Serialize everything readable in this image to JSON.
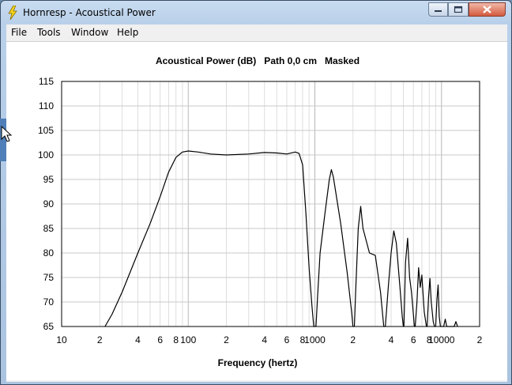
{
  "window": {
    "title": "Hornresp - Acoustical Power"
  },
  "menu": {
    "items": [
      "File",
      "Tools",
      "Window",
      "Help"
    ]
  },
  "chart_data": {
    "type": "line",
    "title": "Acoustical Power (dB)   Path 0,0 cm   Masked",
    "xlabel": "Frequency (hertz)",
    "ylabel": "",
    "x_scale": "log",
    "xlim": [
      10,
      20000
    ],
    "ylim": [
      65,
      115
    ],
    "yticks": [
      115,
      110,
      105,
      100,
      95,
      90,
      85,
      80,
      75,
      70,
      65
    ],
    "xtick_labels": [
      {
        "v": 10,
        "t": "10"
      },
      {
        "v": 20,
        "t": "2"
      },
      {
        "v": 40,
        "t": "4"
      },
      {
        "v": 60,
        "t": "6"
      },
      {
        "v": 80,
        "t": "8"
      },
      {
        "v": 100,
        "t": "100"
      },
      {
        "v": 200,
        "t": "2"
      },
      {
        "v": 400,
        "t": "4"
      },
      {
        "v": 600,
        "t": "6"
      },
      {
        "v": 800,
        "t": "8"
      },
      {
        "v": 1000,
        "t": "1000"
      },
      {
        "v": 2000,
        "t": "2"
      },
      {
        "v": 4000,
        "t": "4"
      },
      {
        "v": 6000,
        "t": "6"
      },
      {
        "v": 8000,
        "t": "8"
      },
      {
        "v": 10000,
        "t": "10000"
      },
      {
        "v": 20000,
        "t": "2"
      }
    ],
    "grid": true,
    "series": [
      {
        "color": "#000000",
        "points": [
          [
            22,
            65
          ],
          [
            25,
            67.5
          ],
          [
            30,
            72
          ],
          [
            40,
            80
          ],
          [
            50,
            86
          ],
          [
            60,
            91.5
          ],
          [
            70,
            96.5
          ],
          [
            80,
            99.5
          ],
          [
            90,
            100.6
          ],
          [
            100,
            100.8
          ],
          [
            120,
            100.6
          ],
          [
            150,
            100.2
          ],
          [
            200,
            100.0
          ],
          [
            300,
            100.2
          ],
          [
            400,
            100.5
          ],
          [
            500,
            100.4
          ],
          [
            600,
            100.2
          ],
          [
            700,
            100.6
          ],
          [
            750,
            100.3
          ],
          [
            800,
            98
          ],
          [
            850,
            88
          ],
          [
            900,
            77
          ],
          [
            950,
            69
          ],
          [
            980,
            65
          ],
          [
            1020,
            65
          ],
          [
            1050,
            71
          ],
          [
            1100,
            80
          ],
          [
            1200,
            88
          ],
          [
            1300,
            95
          ],
          [
            1350,
            97
          ],
          [
            1400,
            95.5
          ],
          [
            1600,
            86
          ],
          [
            1800,
            76
          ],
          [
            1950,
            68
          ],
          [
            2000,
            65
          ],
          [
            2050,
            65
          ],
          [
            2100,
            72
          ],
          [
            2200,
            85
          ],
          [
            2300,
            89.5
          ],
          [
            2400,
            85
          ],
          [
            2700,
            80
          ],
          [
            3000,
            79.5
          ],
          [
            3300,
            72
          ],
          [
            3500,
            65
          ],
          [
            3600,
            65
          ],
          [
            3800,
            73
          ],
          [
            4000,
            80
          ],
          [
            4200,
            84.5
          ],
          [
            4400,
            82
          ],
          [
            4700,
            73
          ],
          [
            4900,
            67
          ],
          [
            5000,
            65
          ],
          [
            5050,
            65
          ],
          [
            5200,
            78
          ],
          [
            5400,
            83
          ],
          [
            5600,
            75
          ],
          [
            5800,
            72
          ],
          [
            6000,
            67.5
          ],
          [
            6100,
            65
          ],
          [
            6200,
            65
          ],
          [
            6400,
            70
          ],
          [
            6600,
            77
          ],
          [
            6800,
            73
          ],
          [
            7000,
            75.5
          ],
          [
            7300,
            68
          ],
          [
            7600,
            65
          ],
          [
            7700,
            65
          ],
          [
            7900,
            71
          ],
          [
            8100,
            74.8
          ],
          [
            8300,
            70
          ],
          [
            8600,
            66
          ],
          [
            8800,
            65
          ],
          [
            9000,
            65
          ],
          [
            9200,
            70.5
          ],
          [
            9400,
            73.5
          ],
          [
            9600,
            67
          ],
          [
            9800,
            65
          ],
          [
            10400,
            65
          ],
          [
            10700,
            66.5
          ],
          [
            11000,
            65
          ],
          [
            12600,
            65
          ],
          [
            13000,
            66
          ],
          [
            13400,
            65
          ]
        ]
      }
    ]
  }
}
